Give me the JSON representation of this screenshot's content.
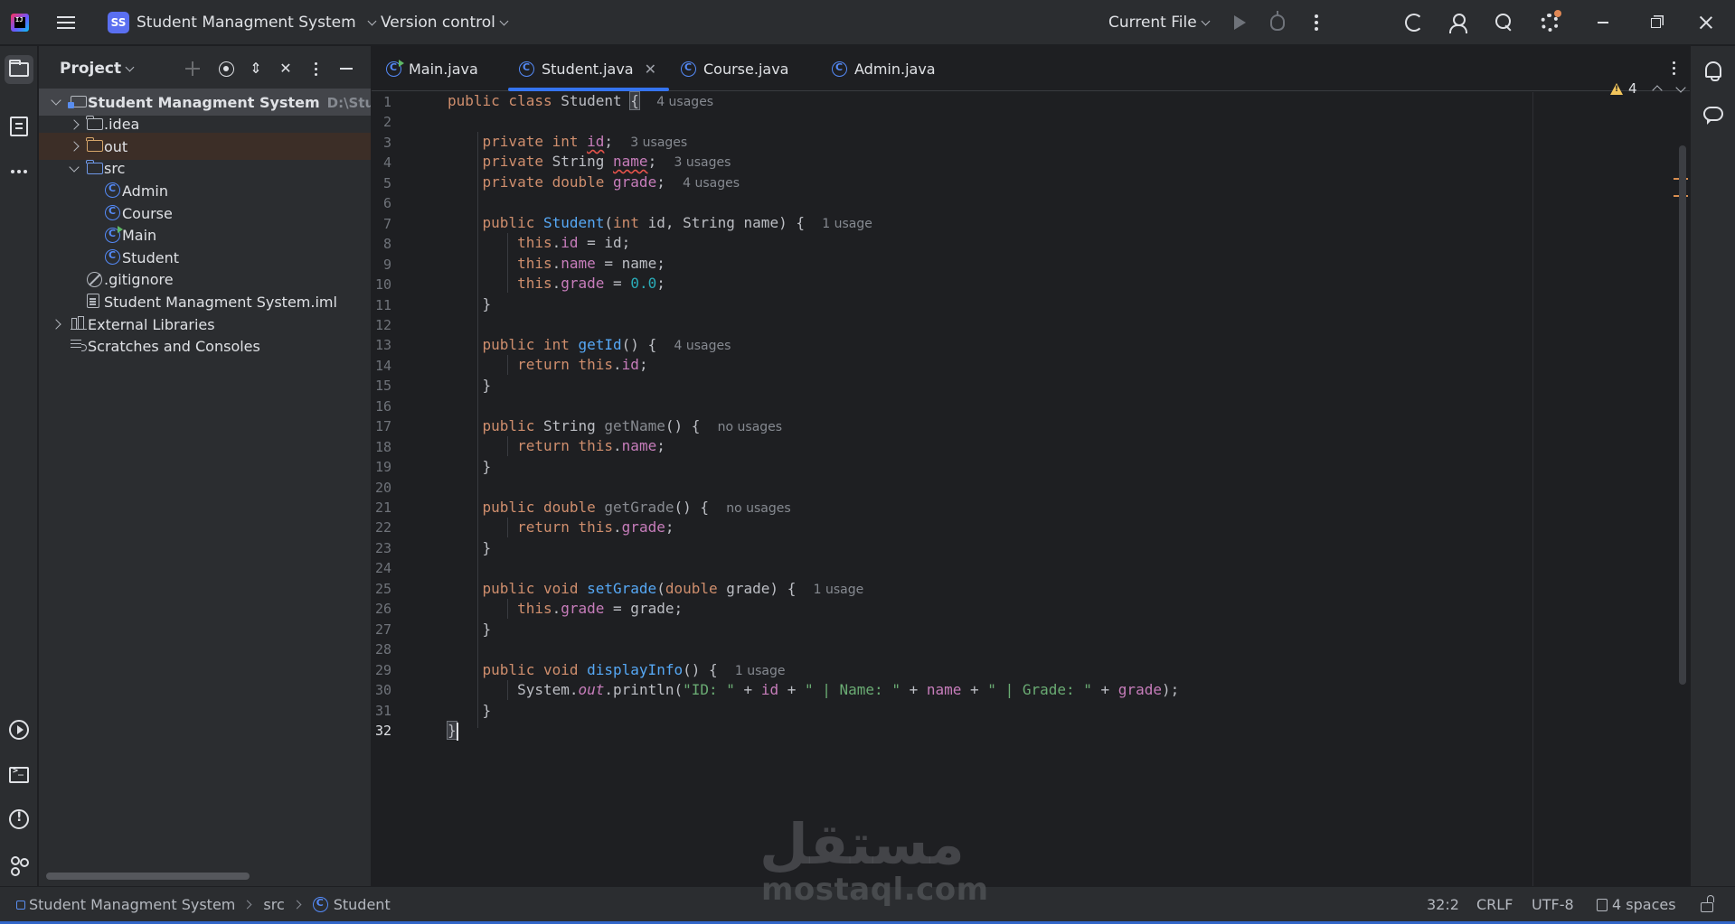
{
  "titlebar": {
    "project_badge": "SS",
    "project_name": "Student Managment System",
    "vcs_label": "Version control",
    "run_config": "Current File"
  },
  "project_panel": {
    "title": "Project",
    "tree": [
      {
        "label": "Student Managment System",
        "path": "D:\\Stu",
        "icon": "module-icon",
        "depth": 0,
        "expanded": true,
        "selected": true
      },
      {
        "label": ".idea",
        "icon": "folder-icon",
        "depth": 1,
        "expanded": false
      },
      {
        "label": "out",
        "icon": "folder-orange-icon",
        "depth": 1,
        "expanded": false,
        "excluded": true
      },
      {
        "label": "src",
        "icon": "folder-blue-icon",
        "depth": 1,
        "expanded": true
      },
      {
        "label": "Admin",
        "icon": "class-icon",
        "depth": 2
      },
      {
        "label": "Course",
        "icon": "class-icon",
        "depth": 2
      },
      {
        "label": "Main",
        "icon": "main-class-icon",
        "depth": 2
      },
      {
        "label": "Student",
        "icon": "class-icon",
        "depth": 2
      },
      {
        "label": ".gitignore",
        "icon": "ignore-file-icon",
        "depth": 1
      },
      {
        "label": "Student Managment System.iml",
        "icon": "iml-file-icon",
        "depth": 1
      },
      {
        "label": "External Libraries",
        "icon": "library-icon",
        "depth": 0,
        "expanded": false
      },
      {
        "label": "Scratches and Consoles",
        "icon": "scratches-icon",
        "depth": 0
      }
    ]
  },
  "tabs": [
    {
      "label": "Main.java",
      "icon": "main-class-icon",
      "active": false
    },
    {
      "label": "Student.java",
      "icon": "class-icon",
      "active": true
    },
    {
      "label": "Course.java",
      "icon": "class-icon",
      "active": false
    },
    {
      "label": "Admin.java",
      "icon": "class-icon",
      "active": false
    }
  ],
  "editor": {
    "line_count": 32,
    "current_line": 32,
    "warning_count": "4",
    "inlay_hints": {
      "class": "4 usages",
      "id": "3 usages",
      "name": "3 usages",
      "grade": "4 usages",
      "ctor": "1 usage",
      "getId": "4 usages",
      "getName": "no usages",
      "getGrade": "no usages",
      "setGrade": "1 usage",
      "displayInfo": "1 usage"
    },
    "strings": {
      "id_label": "\"ID: \"",
      "name_label": "\" | Name: \"",
      "grade_label": "\" | Grade: \""
    },
    "zero": "0.0"
  },
  "statusbar": {
    "breadcrumb": [
      "Student Managment System",
      "src",
      "Student"
    ],
    "position": "32:2",
    "line_ending": "CRLF",
    "encoding": "UTF-8",
    "indent": "4 spaces"
  },
  "watermark": {
    "arabic": "مستقل",
    "latin": "mostaql.com"
  },
  "colors": {
    "accent": "#3574f0",
    "keyword": "#cf8e6d",
    "field": "#c77dbb",
    "method": "#56a8f5",
    "string": "#6aab73",
    "number": "#2aacb8",
    "warning": "#f2c55c"
  }
}
